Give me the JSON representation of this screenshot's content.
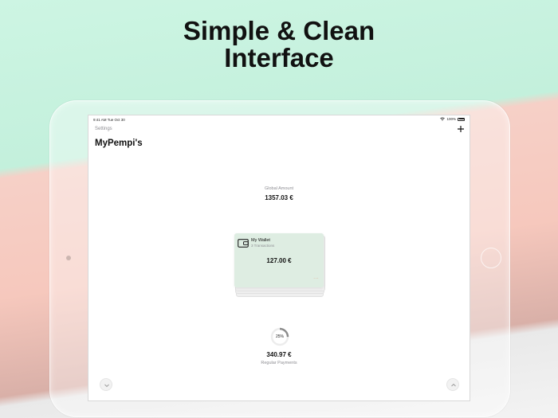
{
  "headline": {
    "line1": "Simple & Clean",
    "line2": "Interface"
  },
  "statusbar": {
    "time": "9:41 AM",
    "date": "Tue Oct 30",
    "battery": "100%"
  },
  "nav": {
    "settings_label": "Settings",
    "title": "MyPempi's",
    "add_icon": "plus-icon"
  },
  "global": {
    "label": "Global Amount",
    "amount": "1357.03 €"
  },
  "wallet": {
    "name": "My Wallet",
    "transactions": "3 Transactions",
    "amount": "127.00 €",
    "more": "···",
    "icon": "wallet-icon",
    "card_color": "#deede2"
  },
  "regular": {
    "percent": "25%",
    "progress": 0.25,
    "amount": "340.97 €",
    "label": "Regular Payments"
  },
  "buttons": {
    "down_icon": "chevron-down-icon",
    "up_icon": "chevron-up-icon"
  },
  "colors": {
    "accent": "#e39a7e",
    "muted_text": "#8e8e93"
  }
}
